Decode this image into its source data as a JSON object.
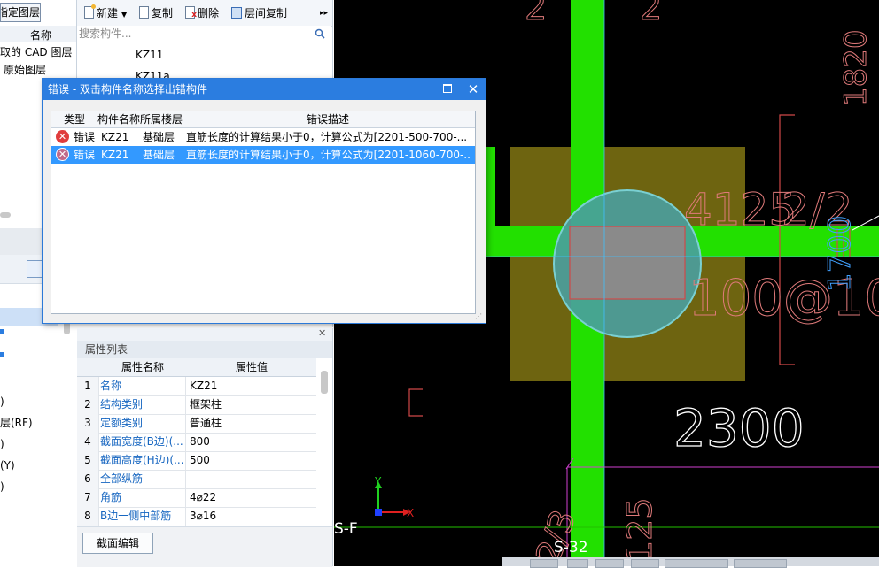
{
  "layer_panel": {
    "button_label": "指定图层",
    "column_header": "名称",
    "items": [
      "取的 CAD 图层",
      "原始图层"
    ]
  },
  "floor_list": {
    "items": [
      ")",
      "层(RF)",
      ")",
      "(Y)",
      ")"
    ]
  },
  "component_panel": {
    "toolbar": {
      "new_label": "新建",
      "copy_label": "复制",
      "delete_label": "删除",
      "floor_copy_label": "层间复制"
    },
    "search_placeholder": "搜索构件...",
    "items": [
      "KZ11",
      "KZ11a"
    ]
  },
  "error_dialog": {
    "title": "错误 - 双击构件名称选择出错构件",
    "columns": {
      "type": "类型",
      "name": "构件名称",
      "floor": "所属楼层",
      "desc": "错误描述"
    },
    "rows": [
      {
        "type": "错误",
        "name": "KZ21",
        "floor": "基础层",
        "desc": "直筋长度的计算结果小于0，计算公式为[2201-500-700-...",
        "selected": false
      },
      {
        "type": "错误",
        "name": "KZ21",
        "floor": "基础层",
        "desc": "直筋长度的计算结果小于0，计算公式为[2201-1060-700-...",
        "selected": true
      }
    ]
  },
  "property_panel": {
    "title": "属性列表",
    "col_name": "属性名称",
    "col_value": "属性值",
    "rows": [
      {
        "num": "1",
        "name": "名称",
        "value": "KZ21"
      },
      {
        "num": "2",
        "name": "结构类别",
        "value": "框架柱"
      },
      {
        "num": "3",
        "name": "定额类别",
        "value": "普通柱"
      },
      {
        "num": "4",
        "name": "截面宽度(B边)(...",
        "value": "800"
      },
      {
        "num": "5",
        "name": "截面高度(H边)(...",
        "value": "500"
      },
      {
        "num": "6",
        "name": "全部纵筋",
        "value": ""
      },
      {
        "num": "7",
        "name": "角筋",
        "value": "4⌀22"
      },
      {
        "num": "8",
        "name": "B边一侧中部筋",
        "value": "3⌀16"
      }
    ],
    "section_edit_label": "截面编辑"
  },
  "cad": {
    "texts": {
      "t_4125": "4125",
      "t_2_2": "2/2",
      "t_100": "100@100",
      "t_2300": "2300",
      "t_1700": "1700",
      "t_sf": "S-F",
      "t_s32": "S-32",
      "t_1820": "1820",
      "t_2_3": "2/3",
      "t_125": "125",
      "t_2_top": "2",
      "t_2_top2": "2",
      "axis_x": "X",
      "axis_y": "Y"
    },
    "colors": {
      "green": "#22e000",
      "column": "#6e6410",
      "circle": "#4a9ea0",
      "rect": "#909090",
      "dim": "#e07a7a",
      "magenta": "#d040d0"
    }
  }
}
